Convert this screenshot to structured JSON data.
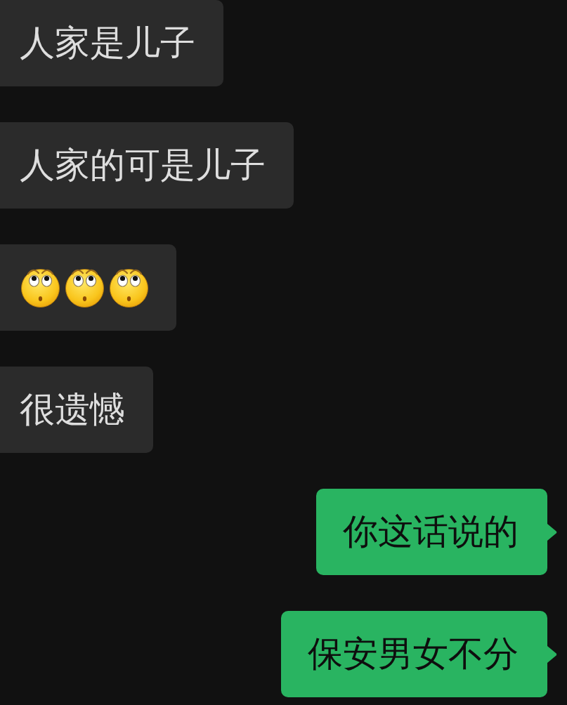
{
  "messages": [
    {
      "outgoing": false,
      "kind": "text",
      "text": "人家是儿子"
    },
    {
      "outgoing": false,
      "kind": "text",
      "text": "人家的可是儿子"
    },
    {
      "outgoing": false,
      "kind": "emoji",
      "emoji": [
        {
          "kind": "face"
        },
        {
          "kind": "face"
        },
        {
          "kind": "face"
        }
      ]
    },
    {
      "outgoing": false,
      "kind": "text",
      "text": "很遗憾"
    },
    {
      "outgoing": true,
      "kind": "text",
      "text": "你这话说的"
    },
    {
      "outgoing": true,
      "kind": "text",
      "text": "保安男女不分"
    }
  ]
}
